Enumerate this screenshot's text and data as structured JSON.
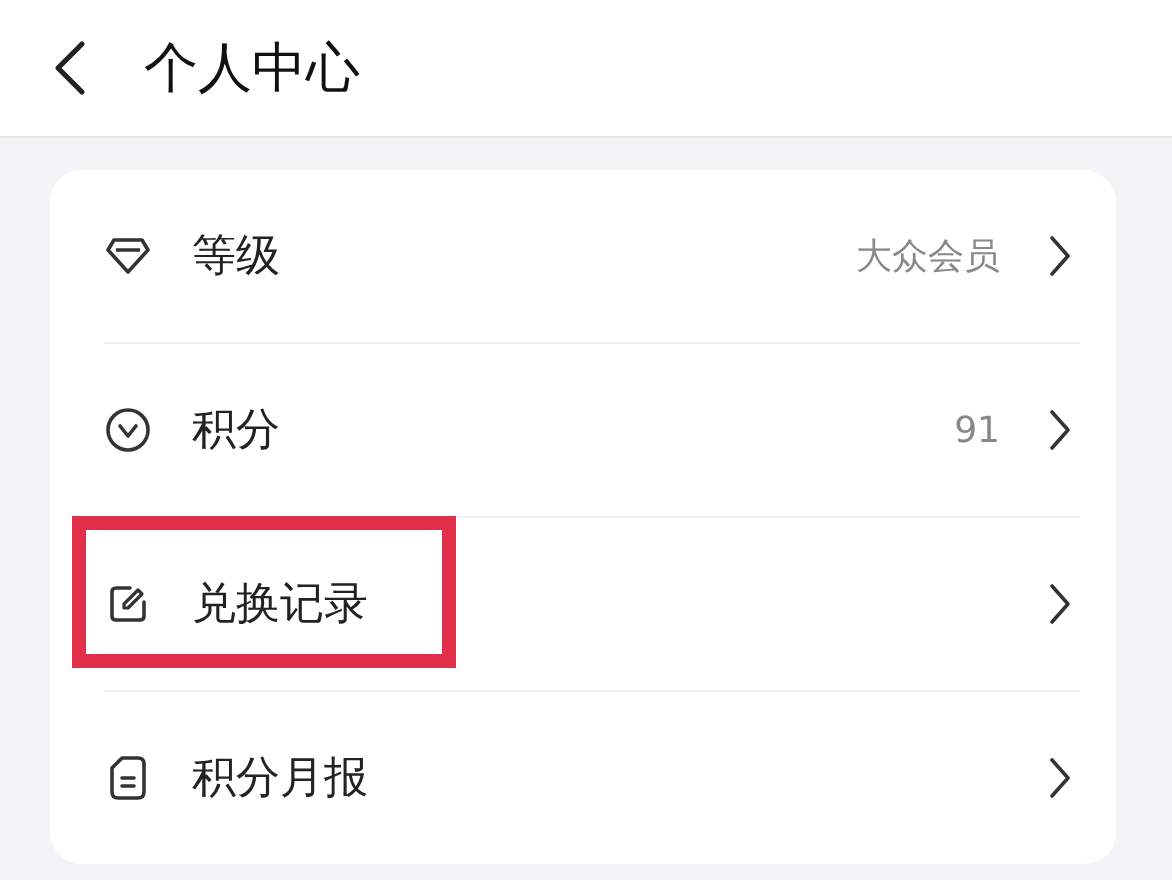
{
  "header": {
    "title": "个人中心"
  },
  "rows": [
    {
      "kind": "level",
      "label": "等级",
      "value": "大众会员",
      "highlighted": false
    },
    {
      "kind": "points",
      "label": "积分",
      "value": "91",
      "highlighted": false
    },
    {
      "kind": "exchange",
      "label": "兑换记录",
      "highlighted": true
    },
    {
      "kind": "report",
      "label": "积分月报",
      "highlighted": false
    }
  ]
}
